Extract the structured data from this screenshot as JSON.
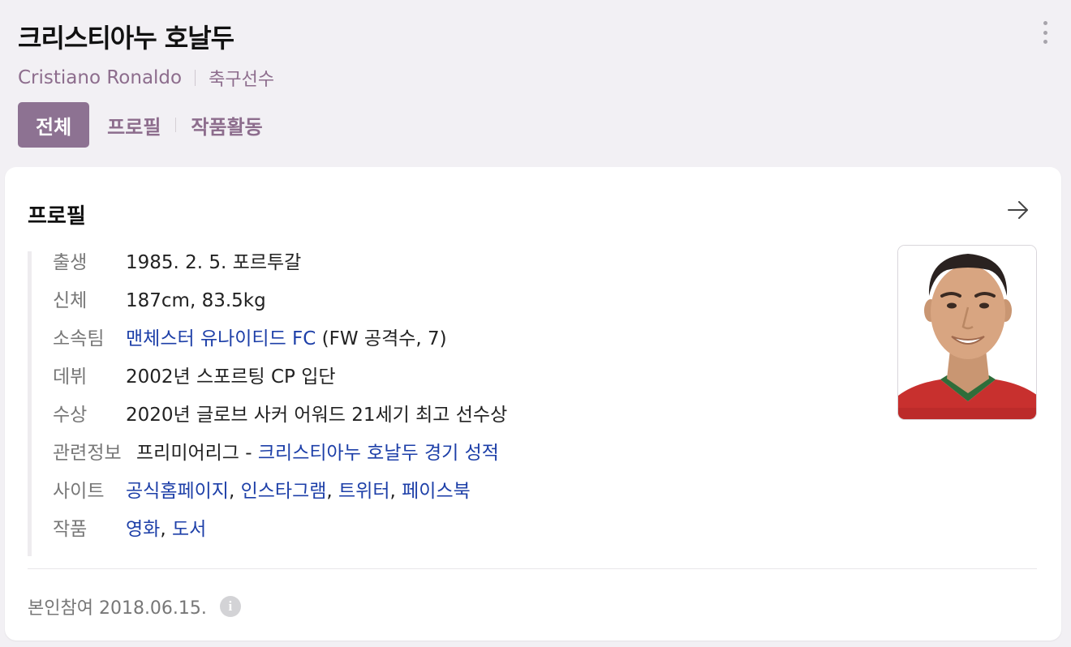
{
  "header": {
    "title": "크리스티아누 호날두",
    "name_en": "Cristiano Ronaldo",
    "category": "축구선수",
    "more_icon": "more-vertical-icon"
  },
  "tabs": [
    {
      "label": "전체",
      "active": true
    },
    {
      "label": "프로필",
      "active": false
    },
    {
      "label": "작품활동",
      "active": false
    }
  ],
  "profile": {
    "title": "프로필",
    "arrow_icon": "arrow-right-icon",
    "rows": {
      "birth": {
        "label": "출생",
        "value": "1985. 2. 5. 포르투갈"
      },
      "body": {
        "label": "신체",
        "value": "187cm, 83.5kg"
      },
      "team": {
        "label": "소속팀",
        "link": "맨체스터 유나이티드 FC",
        "rest": " (FW 공격수, 7)"
      },
      "debut": {
        "label": "데뷔",
        "value": "2002년 스포르팅 CP 입단"
      },
      "award": {
        "label": "수상",
        "value": "2020년 글로브 사커 어워드 21세기 최고 선수상"
      },
      "related": {
        "label": "관련정보",
        "prefix": "프리미어리그 - ",
        "link": "크리스티아누 호날두 경기 성적"
      },
      "site": {
        "label": "사이트",
        "links": [
          "공식홈페이지",
          "인스타그램",
          "트위터",
          "페이스북"
        ],
        "sep": ", "
      },
      "works": {
        "label": "작품",
        "links": [
          "영화",
          "도서"
        ],
        "sep": ", "
      }
    },
    "footer_text": "본인참여 2018.06.15.",
    "info_icon_glyph": "i"
  },
  "colors": {
    "accent": "#8d7292",
    "subtitle": "#8d6d8d",
    "link": "#1d3fa8",
    "background": "#f2f0f4"
  }
}
